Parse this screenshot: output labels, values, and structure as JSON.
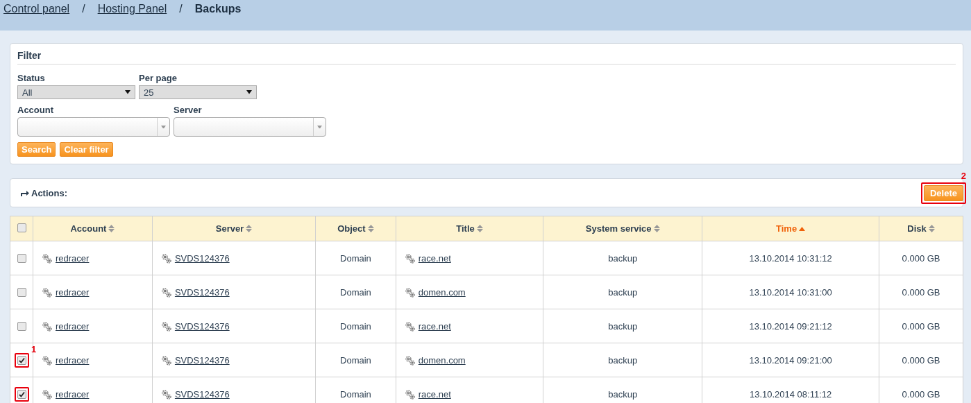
{
  "breadcrumb": [
    {
      "label": "Control panel",
      "link": true
    },
    {
      "label": "Hosting Panel",
      "link": true
    },
    {
      "label": "Backups",
      "link": false
    }
  ],
  "breadcrumb_separator": "/",
  "filter": {
    "title": "Filter",
    "fields": [
      {
        "label": "Status",
        "kind": "select",
        "value": "All"
      },
      {
        "label": "Per page",
        "kind": "select",
        "value": "25"
      },
      {
        "label": "Account",
        "kind": "combo"
      },
      {
        "label": "Server",
        "kind": "combo"
      }
    ],
    "buttons": [
      "Search",
      "Clear filter"
    ]
  },
  "actions": {
    "label": "Actions:",
    "delete": {
      "label": "Delete",
      "outlined": true,
      "callout": "2"
    }
  },
  "table": {
    "select_all": {
      "checked": false
    },
    "columns": [
      {
        "label": "Account",
        "sorted": false
      },
      {
        "label": "Server",
        "sorted": false
      },
      {
        "label": "Object",
        "sorted": false
      },
      {
        "label": "Title",
        "sorted": false
      },
      {
        "label": "System service",
        "sorted": false
      },
      {
        "label": "Time",
        "sorted": true
      },
      {
        "label": "Disk",
        "sorted": false
      }
    ],
    "rows": [
      {
        "checked": false,
        "outlined": false,
        "account": "redracer",
        "server": "SVDS124376",
        "object": "Domain",
        "title": "race.net",
        "service": "backup",
        "time": "13.10.2014 10:31:12",
        "disk": "0.000 GB"
      },
      {
        "checked": false,
        "outlined": false,
        "account": "redracer",
        "server": "SVDS124376",
        "object": "Domain",
        "title": "domen.com",
        "service": "backup",
        "time": "13.10.2014 10:31:00",
        "disk": "0.000 GB"
      },
      {
        "checked": false,
        "outlined": false,
        "account": "redracer",
        "server": "SVDS124376",
        "object": "Domain",
        "title": "race.net",
        "service": "backup",
        "time": "13.10.2014 09:21:12",
        "disk": "0.000 GB"
      },
      {
        "checked": true,
        "outlined": true,
        "callout": "1",
        "account": "redracer",
        "server": "SVDS124376",
        "object": "Domain",
        "title": "domen.com",
        "service": "backup",
        "time": "13.10.2014 09:21:00",
        "disk": "0.000 GB"
      },
      {
        "checked": true,
        "outlined": true,
        "account": "redracer",
        "server": "SVDS124376",
        "object": "Domain",
        "title": "race.net",
        "service": "backup",
        "time": "13.10.2014 08:11:12",
        "disk": "0.000 GB"
      }
    ]
  }
}
